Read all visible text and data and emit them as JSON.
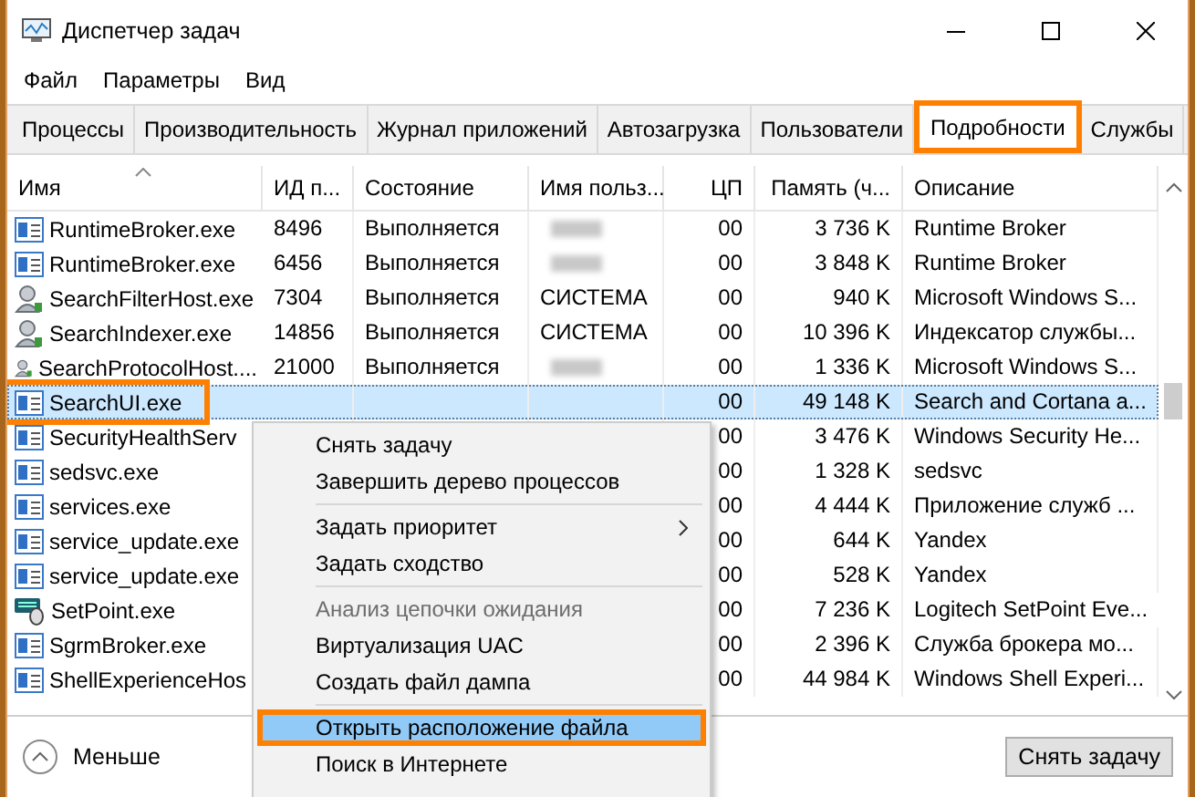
{
  "window": {
    "title": "Диспетчер задач"
  },
  "menu_bar": [
    "Файл",
    "Параметры",
    "Вид"
  ],
  "tabs": [
    {
      "label": "Процессы",
      "selected": false,
      "annotated": false
    },
    {
      "label": "Производительность",
      "selected": false,
      "annotated": false
    },
    {
      "label": "Журнал приложений",
      "selected": false,
      "annotated": false
    },
    {
      "label": "Автозагрузка",
      "selected": false,
      "annotated": false
    },
    {
      "label": "Пользователи",
      "selected": false,
      "annotated": false
    },
    {
      "label": "Подробности",
      "selected": true,
      "annotated": true
    },
    {
      "label": "Службы",
      "selected": false,
      "annotated": false
    }
  ],
  "table": {
    "columns": [
      "Имя",
      "ИД п...",
      "Состояние",
      "Имя польз...",
      "ЦП",
      "Память (ч...",
      "Описание"
    ],
    "rows": [
      {
        "kind": "window",
        "name": "RuntimeBroker.exe",
        "pid": "8496",
        "state": "Выполняется",
        "user_blurred": true,
        "cpu": "00",
        "memory": "3 736 K",
        "description": "Runtime Broker",
        "selected": false,
        "annotated": false
      },
      {
        "kind": "window",
        "name": "RuntimeBroker.exe",
        "pid": "6456",
        "state": "Выполняется",
        "user_blurred": true,
        "cpu": "00",
        "memory": "3 848 K",
        "description": "Runtime Broker",
        "selected": false,
        "annotated": false
      },
      {
        "kind": "search",
        "name": "SearchFilterHost.exe",
        "pid": "7304",
        "state": "Выполняется",
        "user": "СИСТЕМА",
        "cpu": "00",
        "memory": "940 K",
        "description": "Microsoft Windows S...",
        "selected": false,
        "annotated": false
      },
      {
        "kind": "search",
        "name": "SearchIndexer.exe",
        "pid": "14856",
        "state": "Выполняется",
        "user": "СИСТЕМА",
        "cpu": "00",
        "memory": "10 396 K",
        "description": "Индексатор службы...",
        "selected": false,
        "annotated": false
      },
      {
        "kind": "search",
        "name": "SearchProtocolHost....",
        "pid": "21000",
        "state": "Выполняется",
        "user_blurred": true,
        "cpu": "00",
        "memory": "1 336 K",
        "description": "Microsoft Windows S...",
        "selected": false,
        "annotated": false
      },
      {
        "kind": "window",
        "name": "SearchUI.exe",
        "cpu": "00",
        "memory": "49 148 K",
        "description": "Search and Cortana a...",
        "selected": true,
        "annotated": true
      },
      {
        "kind": "window",
        "name": "SecurityHealthServ",
        "cpu": "00",
        "memory": "3 476 K",
        "description": "Windows Security He...",
        "selected": false,
        "annotated": false
      },
      {
        "kind": "window",
        "name": "sedsvc.exe",
        "cpu": "00",
        "memory": "1 328 K",
        "description": "sedsvc",
        "selected": false,
        "annotated": false
      },
      {
        "kind": "window",
        "name": "services.exe",
        "cpu": "00",
        "memory": "4 444 K",
        "description": "Приложение служб ...",
        "selected": false,
        "annotated": false
      },
      {
        "kind": "window",
        "name": "service_update.exe",
        "cpu": "00",
        "memory": "644 K",
        "description": "Yandex",
        "selected": false,
        "annotated": false
      },
      {
        "kind": "window",
        "name": "service_update.exe",
        "cpu": "00",
        "memory": "528 K",
        "description": "Yandex",
        "selected": false,
        "annotated": false
      },
      {
        "kind": "mouse",
        "name": "SetPoint.exe",
        "cpu": "00",
        "memory": "7 236 K",
        "description": "Logitech SetPoint Eve...",
        "selected": false,
        "annotated": false
      },
      {
        "kind": "window",
        "name": "SgrmBroker.exe",
        "cpu": "00",
        "memory": "2 396 K",
        "description": "Служба брокера мо...",
        "selected": false,
        "annotated": false
      },
      {
        "kind": "window",
        "name": "ShellExperienceHos",
        "cpu": "00",
        "memory": "44 984 K",
        "description": "Windows Shell Experi...",
        "selected": false,
        "annotated": false
      }
    ]
  },
  "context_menu": [
    {
      "kind": "item",
      "label": "Снять задачу",
      "disabled": false,
      "selected": false,
      "annotated": false
    },
    {
      "kind": "item",
      "label": "Завершить дерево процессов",
      "disabled": false,
      "selected": false,
      "annotated": false
    },
    {
      "kind": "separator"
    },
    {
      "kind": "submenu",
      "label": "Задать приоритет",
      "disabled": false,
      "selected": false,
      "annotated": false
    },
    {
      "kind": "item",
      "label": "Задать сходство",
      "disabled": false,
      "selected": false,
      "annotated": false
    },
    {
      "kind": "separator"
    },
    {
      "kind": "item",
      "label": "Анализ цепочки ожидания",
      "disabled": true,
      "selected": false,
      "annotated": false
    },
    {
      "kind": "item",
      "label": "Виртуализация UAC",
      "disabled": false,
      "selected": false,
      "annotated": false
    },
    {
      "kind": "item",
      "label": "Создать файл дампа",
      "disabled": false,
      "selected": false,
      "annotated": false
    },
    {
      "kind": "separator"
    },
    {
      "kind": "item",
      "label": "Открыть расположение файла",
      "disabled": false,
      "selected": true,
      "annotated": true
    },
    {
      "kind": "item",
      "label": "Поиск в Интернете",
      "disabled": false,
      "selected": false,
      "annotated": false
    }
  ],
  "footer": {
    "toggle": "Меньше",
    "button": "Снять задачу"
  }
}
